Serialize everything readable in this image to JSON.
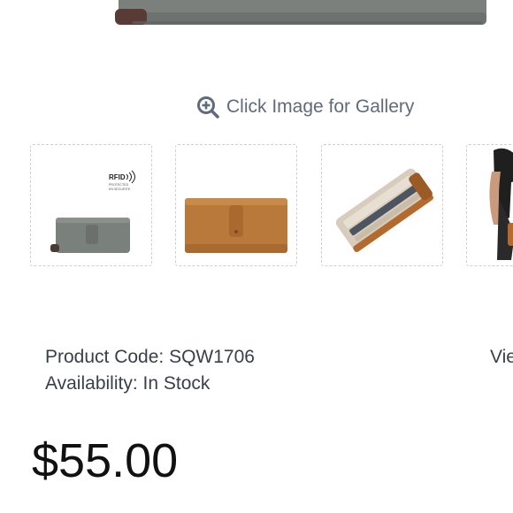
{
  "gallery": {
    "link_label": "Click Image for Gallery",
    "icon": "zoom-in-icon"
  },
  "thumbnails": [
    {
      "name": "grey-wallet-rfid",
      "badge_title": "RFID",
      "badge_sub_1": "PROTECTED",
      "badge_sub_2": "EN SECURITE"
    },
    {
      "name": "tan-wallet"
    },
    {
      "name": "open-wallet-interior"
    },
    {
      "name": "model-wearing-bag"
    }
  ],
  "product": {
    "code_label": "Product Code:",
    "code_value": "SQW1706",
    "availability_label": "Availability:",
    "availability_value": "In Stock",
    "right_cut_text": "Vie",
    "price": "$55.00"
  },
  "colors": {
    "link": "#5f6b7a",
    "text": "#3a3f47",
    "price": "#111111",
    "wallet_grey": "#7a7f7c",
    "wallet_tan": "#b9793a"
  }
}
